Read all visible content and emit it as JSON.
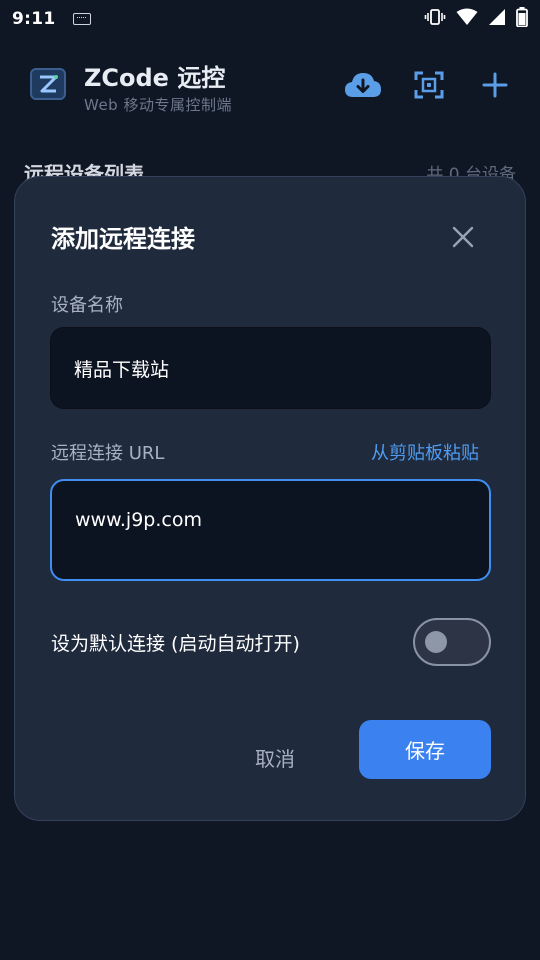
{
  "status_bar": {
    "time": "9:11",
    "icons": [
      "keyboard-icon",
      "vibrate-icon",
      "wifi-icon",
      "signal-icon",
      "battery-icon"
    ]
  },
  "app": {
    "title": "ZCode 远控",
    "subtitle": "Web 移动专属控制端",
    "actions": [
      "cloud-download-icon",
      "scan-icon",
      "add-icon"
    ]
  },
  "device_list": {
    "title": "远程设备列表",
    "count": "共 0 台设备"
  },
  "dialog": {
    "title": "添加远程连接",
    "name_label": "设备名称",
    "name_value": "精品下载站",
    "url_label": "远程连接 URL",
    "paste_label": "从剪贴板粘贴",
    "url_value": "www.j9p.com",
    "default_toggle_label": "设为默认连接 (启动自动打开)",
    "default_toggle_on": false,
    "cancel_label": "取消",
    "save_label": "保存"
  },
  "colors": {
    "background": "#0f1624",
    "dialog": "#1f2a3d",
    "accent": "#3b82f0",
    "link": "#4f9cf2",
    "input": "#0d1421"
  }
}
